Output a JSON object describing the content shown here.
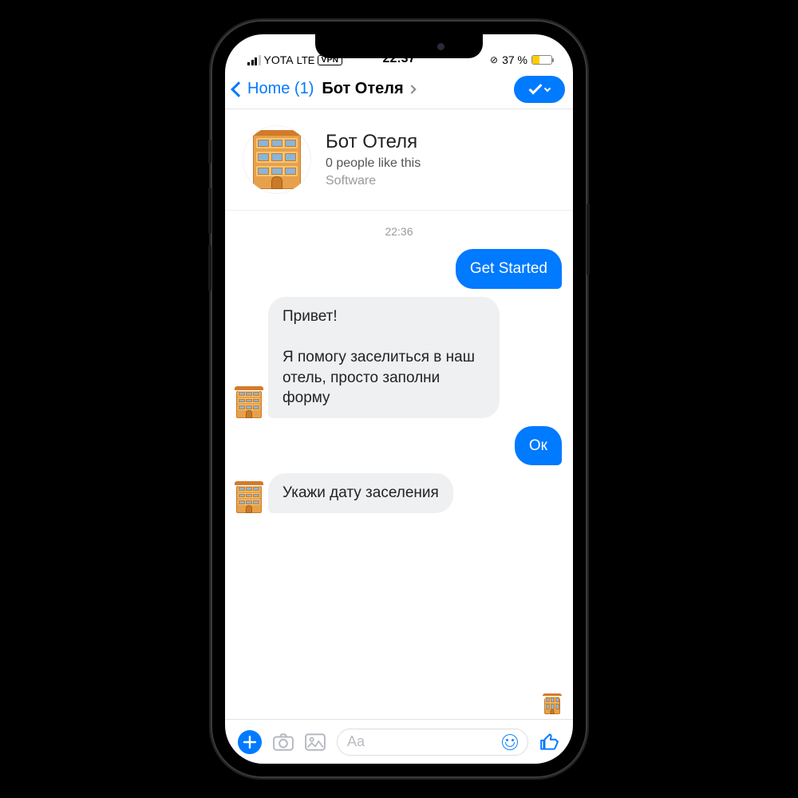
{
  "statusbar": {
    "carrier": "YOTA",
    "network": "LTE",
    "vpn": "VPN",
    "time": "22:37",
    "battery_pct": "37 %"
  },
  "nav": {
    "back_label": "Home (1)",
    "title": "Бот Отеля"
  },
  "profile": {
    "name": "Бот Отеля",
    "likes": "0 people like this",
    "category": "Software"
  },
  "chat": {
    "timestamp": "22:36",
    "messages": [
      {
        "side": "out",
        "text": "Get Started"
      },
      {
        "side": "in",
        "text": "Привет!\n\nЯ помогу заселиться в наш отель, просто заполни форму"
      },
      {
        "side": "out",
        "text": "Ок"
      },
      {
        "side": "in",
        "text": "Укажи дату заселения"
      }
    ]
  },
  "composer": {
    "placeholder": "Aa"
  }
}
